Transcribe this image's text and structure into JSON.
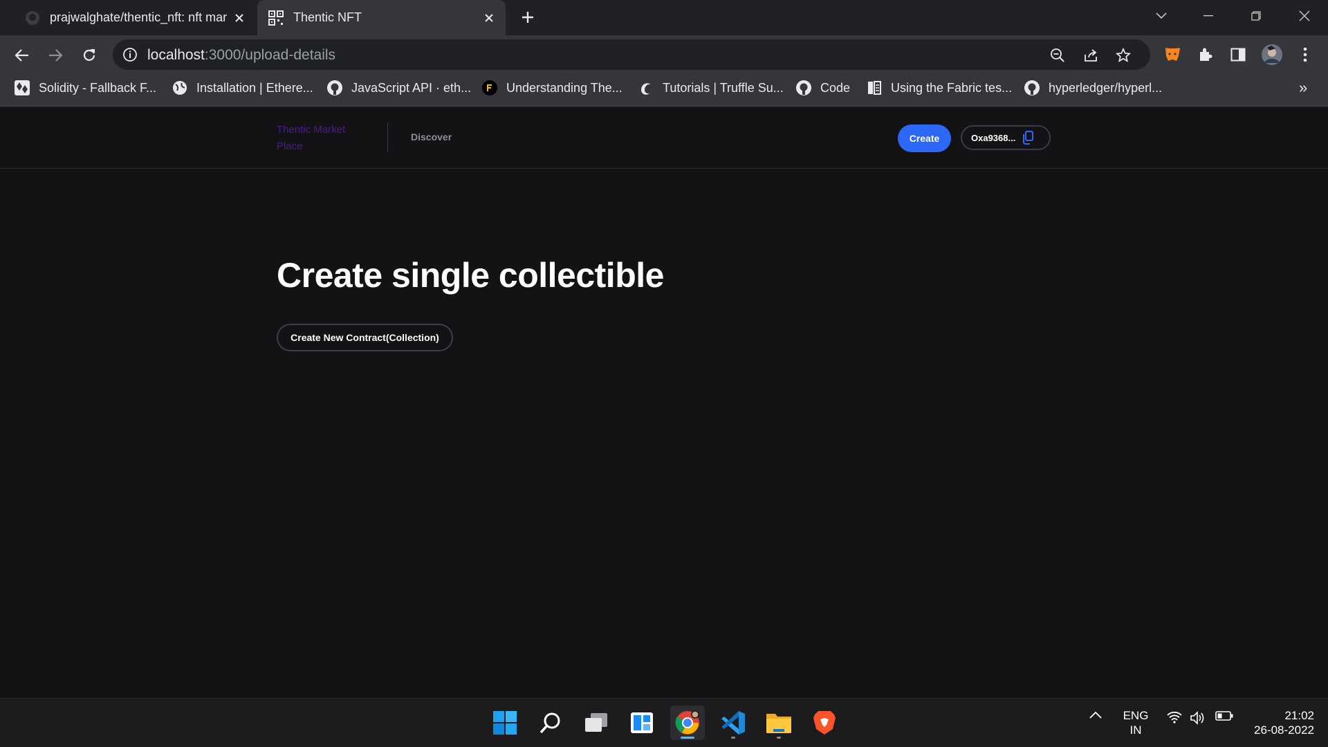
{
  "browser": {
    "tabs": [
      {
        "title": "prajwalghate/thentic_nft: nft mar",
        "icon": "github-icon",
        "active": false
      },
      {
        "title": "Thentic NFT",
        "icon": "qr-code-icon",
        "active": true
      }
    ],
    "address": {
      "host": "localhost",
      "path": ":3000/upload-details"
    },
    "bookmarks": [
      {
        "label": "Solidity - Fallback F...",
        "icon": "solidity-icon"
      },
      {
        "label": "Installation | Ethere...",
        "icon": "globe-icon"
      },
      {
        "label": "JavaScript API · eth...",
        "icon": "github-icon"
      },
      {
        "label": "Understanding The...",
        "icon": "site-icon"
      },
      {
        "label": "Tutorials | Truffle Su...",
        "icon": "truffle-icon"
      },
      {
        "label": "Code",
        "icon": "github-icon"
      },
      {
        "label": "Using the Fabric tes...",
        "icon": "docs-icon"
      },
      {
        "label": "hyperledger/hyperl...",
        "icon": "github-icon"
      }
    ],
    "overflow": "»"
  },
  "page": {
    "nav": {
      "brand": "Thentic Market Place",
      "discover": "Discover",
      "create": "Create",
      "wallet": "Oxa9368..."
    },
    "title": "Create single collectible",
    "contract_button": "Create New Contract(Collection)"
  },
  "taskbar": {
    "apps": [
      "windows-start-icon",
      "search-icon",
      "task-view-icon",
      "widgets-icon",
      "chrome-icon",
      "vscode-icon",
      "file-explorer-icon",
      "brave-icon"
    ],
    "lang_line1": "ENG",
    "lang_line2": "IN",
    "time": "21:02",
    "date": "26-08-2022"
  },
  "colors": {
    "page_bg": "#131316",
    "accent_blue": "#2d67f6",
    "brand_purple": "#4b1b8c",
    "taskbar_active": "#4cc2ff"
  }
}
